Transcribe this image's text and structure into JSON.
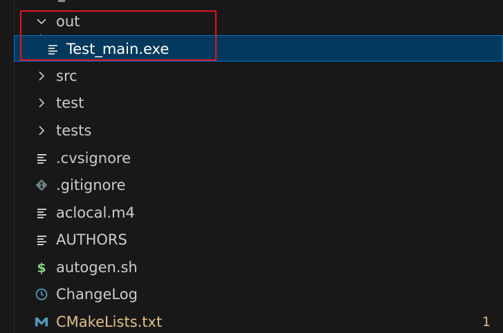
{
  "explorer": {
    "items": [
      {
        "label": "out",
        "kind": "folder",
        "state": "expanded",
        "icon": "chevron-down-icon"
      },
      {
        "label": "Test_main.exe",
        "kind": "file",
        "selected": true,
        "icon": "file-lines-icon"
      },
      {
        "label": "src",
        "kind": "folder",
        "state": "collapsed",
        "icon": "chevron-right-icon"
      },
      {
        "label": "test",
        "kind": "folder",
        "state": "collapsed",
        "icon": "chevron-right-icon"
      },
      {
        "label": "tests",
        "kind": "folder",
        "state": "collapsed",
        "icon": "chevron-right-icon"
      },
      {
        "label": ".cvsignore",
        "kind": "file",
        "icon": "file-lines-icon"
      },
      {
        "label": ".gitignore",
        "kind": "file",
        "icon": "git-icon"
      },
      {
        "label": "aclocal.m4",
        "kind": "file",
        "icon": "file-lines-icon"
      },
      {
        "label": "AUTHORS",
        "kind": "file",
        "icon": "file-lines-icon"
      },
      {
        "label": "autogen.sh",
        "kind": "file",
        "icon": "shell-dollar-icon"
      },
      {
        "label": "ChangeLog",
        "kind": "file",
        "icon": "clock-icon"
      },
      {
        "label": "CMakeLists.txt",
        "kind": "file",
        "icon": "cmake-m-icon",
        "modified": true,
        "badge": "1"
      }
    ]
  },
  "colors": {
    "background": "#181818",
    "text": "#cccccc",
    "selection_bg": "#04395e",
    "selection_border": "#0078d4",
    "annotation_box": "#e81123",
    "modified_text": "#e2c08d",
    "shell_icon": "#89d185",
    "clock_icon": "#519aba",
    "cmake_icon": "#519aba",
    "git_icon": "#6d8086"
  }
}
